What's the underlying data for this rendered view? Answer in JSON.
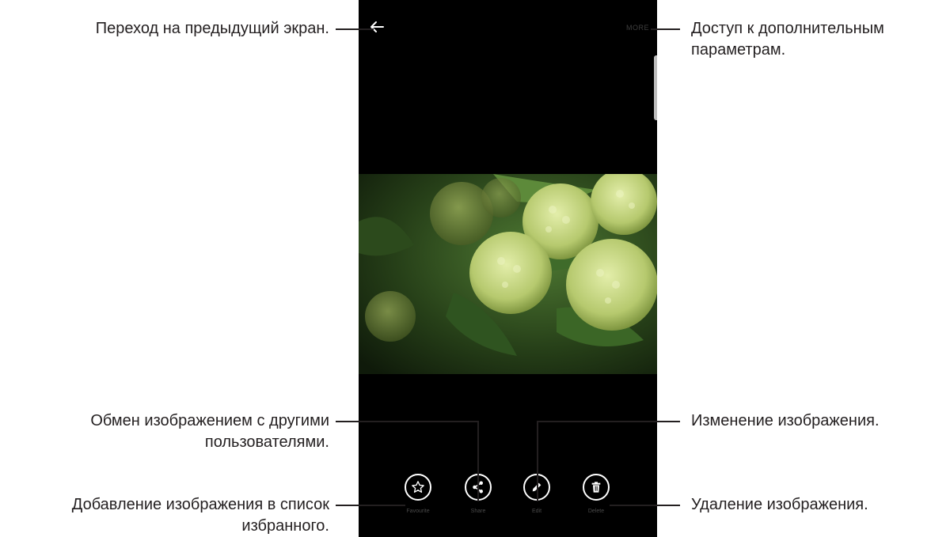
{
  "callouts": {
    "back": "Переход на предыдущий экран.",
    "more_line1": "Доступ к дополнительным",
    "more_line2": "параметрам.",
    "share_line1": "Обмен изображением с другими",
    "share_line2": "пользователями.",
    "edit": "Изменение изображения.",
    "favourite_line1": "Добавление изображения в список",
    "favourite_line2": "избранного.",
    "delete": "Удаление изображения."
  },
  "screen": {
    "more_label": "MORE",
    "actions": {
      "favourite": "Favourite",
      "share": "Share",
      "edit": "Edit",
      "delete": "Delete"
    }
  },
  "icons": {
    "back": "arrow-left-icon",
    "favourite": "star-icon",
    "share": "share-icon",
    "edit": "pencil-icon",
    "delete": "trash-icon"
  },
  "colors": {
    "screen_background": "#000000",
    "photo_flower": "#c8d98a",
    "photo_leaf": "#3f6b2a"
  }
}
